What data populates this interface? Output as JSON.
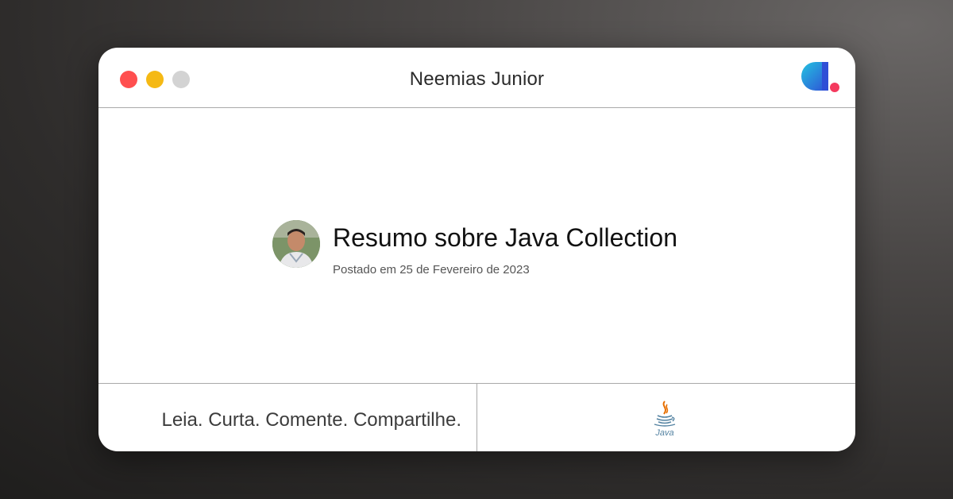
{
  "window": {
    "title": "Neemias Junior",
    "controls": {
      "close_color": "#ff4f4f",
      "minimize_color": "#f5b914",
      "maximize_color": "#d3d3d3"
    }
  },
  "brand": {
    "icon": "dio-logo-icon",
    "colors": {
      "primary_blue": "#2f6fd6",
      "accent_cyan": "#23c4e0",
      "dot": "#f43a5e"
    }
  },
  "post": {
    "avatar_icon": "author-avatar",
    "title": "Resumo sobre Java Collection",
    "date": "Postado em 25 de Fevereiro de 2023"
  },
  "footer": {
    "tagline": "Leia. Curta. Comente. Compartilhe.",
    "tech_icon": "java-logo-icon",
    "tech_label": "Java"
  }
}
